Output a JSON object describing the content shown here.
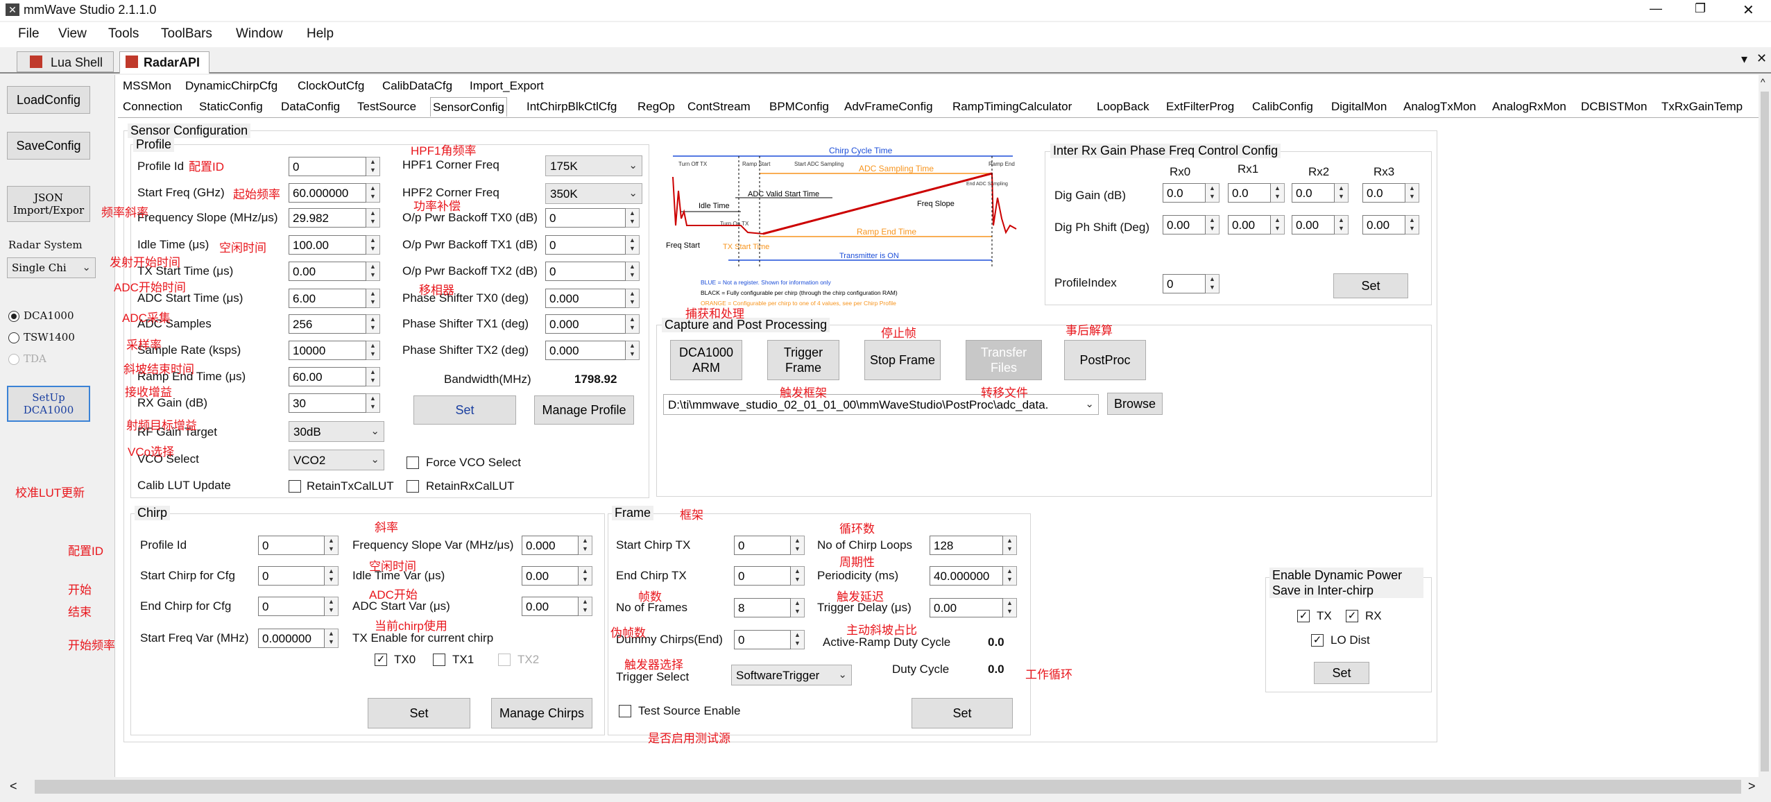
{
  "window": {
    "title": "mmWave Studio 2.1.1.0",
    "controls": {
      "minimize": "—",
      "restore": "❐",
      "close": "✕"
    }
  },
  "menu": [
    "File",
    "View",
    "Tools",
    "ToolBars",
    "Window",
    "Help"
  ],
  "doc_tabs": [
    {
      "label": "Lua Shell",
      "active": false
    },
    {
      "label": "RadarAPI",
      "active": true
    }
  ],
  "doc_tab_controls": {
    "dropdown": "▾",
    "close": "✕"
  },
  "left_panel": {
    "load_config": "LoadConfig",
    "save_config": "SaveConfig",
    "json_import": "JSON Import/Expor",
    "radar_system_label": "Radar System",
    "radar_system_value": "Single Chi",
    "radio_dca1000": "DCA1000",
    "radio_tsw1400": "TSW1400",
    "radio_tda": "TDA",
    "setup_dca1000": "SetUp DCA1000"
  },
  "tabs_row1": [
    "MSSMon",
    "DynamicChirpCfg",
    "ClockOutCfg",
    "CalibDataCfg",
    "Import_Export"
  ],
  "tabs_row2": [
    "Connection",
    "StaticConfig",
    "DataConfig",
    "TestSource",
    "SensorConfig",
    "IntChirpBlkCtlCfg",
    "RegOp",
    "ContStream",
    "BPMConfig",
    "AdvFrameConfig",
    "RampTimingCalculator",
    "LoopBack",
    "ExtFilterProg",
    "CalibConfig",
    "DigitalMon",
    "AnalogTxMon",
    "AnalogRxMon",
    "DCBISTMon",
    "TxRxGainTemp"
  ],
  "active_tab": "SensorConfig",
  "sensor_config": {
    "title": "Sensor Configuration",
    "profile": {
      "title": "Profile",
      "fields": [
        {
          "label": "Profile Id",
          "value": "0"
        },
        {
          "label": "Start Freq (GHz)",
          "value": "60.000000"
        },
        {
          "label": "Frequency Slope (MHz/μs)",
          "value": "29.982"
        },
        {
          "label": "Idle Time (μs)",
          "value": "100.00"
        },
        {
          "label": "TX Start Time (μs)",
          "value": "0.00"
        },
        {
          "label": "ADC Start Time (μs)",
          "value": "6.00"
        },
        {
          "label": "ADC Samples",
          "value": "256"
        },
        {
          "label": "Sample Rate (ksps)",
          "value": "10000"
        },
        {
          "label": "Ramp End Time (μs)",
          "value": "60.00"
        },
        {
          "label": "RX Gain (dB)",
          "value": "30"
        }
      ],
      "rf_gain_target_label": "RF Gain Target",
      "rf_gain_target_value": "30dB",
      "vco_select_label": "VCO Select",
      "vco_select_value": "VCO2",
      "calib_lut_label": "Calib LUT Update",
      "retain_tx": "RetainTxCalLUT",
      "retain_rx": "RetainRxCalLUT",
      "force_vco": "Force VCO Select",
      "right_fields": [
        {
          "label": "HPF1 Corner Freq",
          "value": "175K",
          "type": "combo"
        },
        {
          "label": "HPF2 Corner Freq",
          "value": "350K",
          "type": "combo"
        },
        {
          "label": "O/p Pwr Backoff TX0 (dB)",
          "value": "0",
          "type": "spin"
        },
        {
          "label": "O/p Pwr Backoff TX1 (dB)",
          "value": "0",
          "type": "spin"
        },
        {
          "label": "O/p Pwr Backoff TX2 (dB)",
          "value": "0",
          "type": "spin"
        },
        {
          "label": "Phase Shifter TX0 (deg)",
          "value": "0.000",
          "type": "spin"
        },
        {
          "label": "Phase Shifter TX1 (deg)",
          "value": "0.000",
          "type": "spin"
        },
        {
          "label": "Phase Shifter TX2 (deg)",
          "value": "0.000",
          "type": "spin"
        }
      ],
      "bandwidth_label": "Bandwidth(MHz)",
      "bandwidth_value": "1798.92",
      "set": "Set",
      "manage_profile": "Manage Profile"
    },
    "diagram": {
      "chirp_cycle_time": "Chirp Cycle Time",
      "turn_off_tx": "Turn Off TX",
      "ramp_start": "Ramp Start",
      "start_adc_sampling": "Start ADC Sampling",
      "ramp_end": "Ramp End",
      "adc_sampling_time": "ADC Sampling Time",
      "end_adc_sampling": "End ADC Sampling",
      "adc_valid_start_time": "ADC Valid Start Time",
      "idle_time": "Idle Time",
      "freq_slope": "Freq Slope",
      "turn_on_tx": "Turn On TX",
      "freq_start": "Freq Start",
      "ramp_end_time": "Ramp End Time",
      "tx_start_time": "TX Start Time",
      "transmitter_on": "Transmitter is ON",
      "legend_blue": "BLUE = Not a register. Shown for information only",
      "legend_black": "BLACK = Fully configurable per chirp (through the chirp configuration RAM)",
      "legend_orange": "ORANGE = Configurable per chirp to one of 4 values, see per Chirp Profile"
    },
    "inter_rx": {
      "title": "Inter Rx Gain Phase Freq Control Config",
      "columns": [
        "Rx0",
        "Rx1",
        "Rx2",
        "Rx3"
      ],
      "dig_gain_label": "Dig Gain (dB)",
      "dig_gain_values": [
        "0.0",
        "0.0",
        "0.0",
        "0.0"
      ],
      "dig_ph_label": "Dig Ph Shift (Deg)",
      "dig_ph_values": [
        "0.00",
        "0.00",
        "0.00",
        "0.00"
      ],
      "profile_index_label": "ProfileIndex",
      "profile_index_value": "0",
      "set": "Set"
    },
    "capture": {
      "title": "Capture and Post Processing",
      "dca1000_arm": "DCA1000 ARM",
      "trigger_frame": "Trigger Frame",
      "stop_frame": "Stop Frame",
      "transfer_files": "Transfer Files",
      "post_proc": "PostProc",
      "path": "D:\\ti\\mmwave_studio_02_01_01_00\\mmWaveStudio\\PostProc\\adc_data.",
      "browse": "Browse"
    },
    "chirp": {
      "title": "Chirp",
      "left_fields": [
        {
          "label": "Profile Id",
          "value": "0"
        },
        {
          "label": "Start Chirp for Cfg",
          "value": "0"
        },
        {
          "label": "End Chirp for Cfg",
          "value": "0"
        },
        {
          "label": "Start Freq Var (MHz)",
          "value": "0.000000"
        }
      ],
      "right_fields": [
        {
          "label": "Frequency Slope Var (MHz/μs)",
          "value": "0.000"
        },
        {
          "label": "Idle Time Var (μs)",
          "value": "0.00"
        },
        {
          "label": "ADC Start Var (μs)",
          "value": "0.00"
        }
      ],
      "tx_enable_label": "TX Enable for current chirp",
      "tx0": "TX0",
      "tx1": "TX1",
      "tx2": "TX2",
      "set": "Set",
      "manage_chirps": "Manage Chirps"
    },
    "frame": {
      "title": "Frame",
      "left_fields": [
        {
          "label": "Start Chirp TX",
          "value": "0"
        },
        {
          "label": "End Chirp TX",
          "value": "0"
        },
        {
          "label": "No of Frames",
          "value": "8"
        },
        {
          "label": "Dummy Chirps(End)",
          "value": "0"
        }
      ],
      "right_fields": [
        {
          "label": "No of Chirp Loops",
          "value": "128"
        },
        {
          "label": "Periodicity (ms)",
          "value": "40.000000"
        },
        {
          "label": "Trigger Delay (μs)",
          "value": "0.00"
        }
      ],
      "active_ramp_label": "Active-Ramp Duty Cycle",
      "active_ramp_value": "0.0",
      "trigger_select_label": "Trigger Select",
      "trigger_select_value": "SoftwareTrigger",
      "duty_cycle_label": "Duty Cycle",
      "duty_cycle_value": "0.0",
      "test_source_enable": "Test Source Enable",
      "set": "Set"
    },
    "dynamic_power": {
      "title": "Enable Dynamic Power Save in Inter-chirp",
      "tx": "TX",
      "rx": "RX",
      "lo_dist": "LO Dist",
      "set": "Set"
    }
  },
  "annotations": {
    "hpf1": "HPF1角频率",
    "profile_id": "配置ID",
    "start_freq": "起始频率",
    "power_backoff": "功率补偿",
    "freq_slope": "频率斜率",
    "idle_time": "空闲时间",
    "tx_start": "发射开始时间",
    "adc_start": "ADC开始时间",
    "phase_shifter": "移相器",
    "adc_samples": "ADC采集",
    "sample_rate": "采样率",
    "ramp_end": "斜坡结束时间",
    "rx_gain": "接收增益",
    "rf_gain": "射频目标增益",
    "vco": "VCo选择",
    "calib_lut": "校准LUT更新",
    "capture": "捕获和处理",
    "stop_frame": "停止帧",
    "post_proc": "事后解算",
    "trigger_frame": "触发框架",
    "transfer_files": "转移文件",
    "chirp_slope": "斜率",
    "chirp_idle": "空闲时间",
    "chirp_adc": "ADC开始",
    "chirp_tx_en": "当前chirp使用",
    "chirp_profile_id": "配置ID",
    "chirp_start": "开始",
    "chirp_end": "结束",
    "chirp_start_freq": "开始频率",
    "frame": "框架",
    "loops": "循环数",
    "periodicity": "周期性",
    "frames": "帧数",
    "trigger_delay": "触发延迟",
    "dummy": "伪帧数",
    "active_ramp": "主动斜坡占比",
    "trigger_select": "触发器选择",
    "duty_cycle": "工作循环",
    "test_source": "是否启用测试源"
  },
  "scrollbar": {
    "left": "<",
    "right": ">",
    "up": "^"
  }
}
